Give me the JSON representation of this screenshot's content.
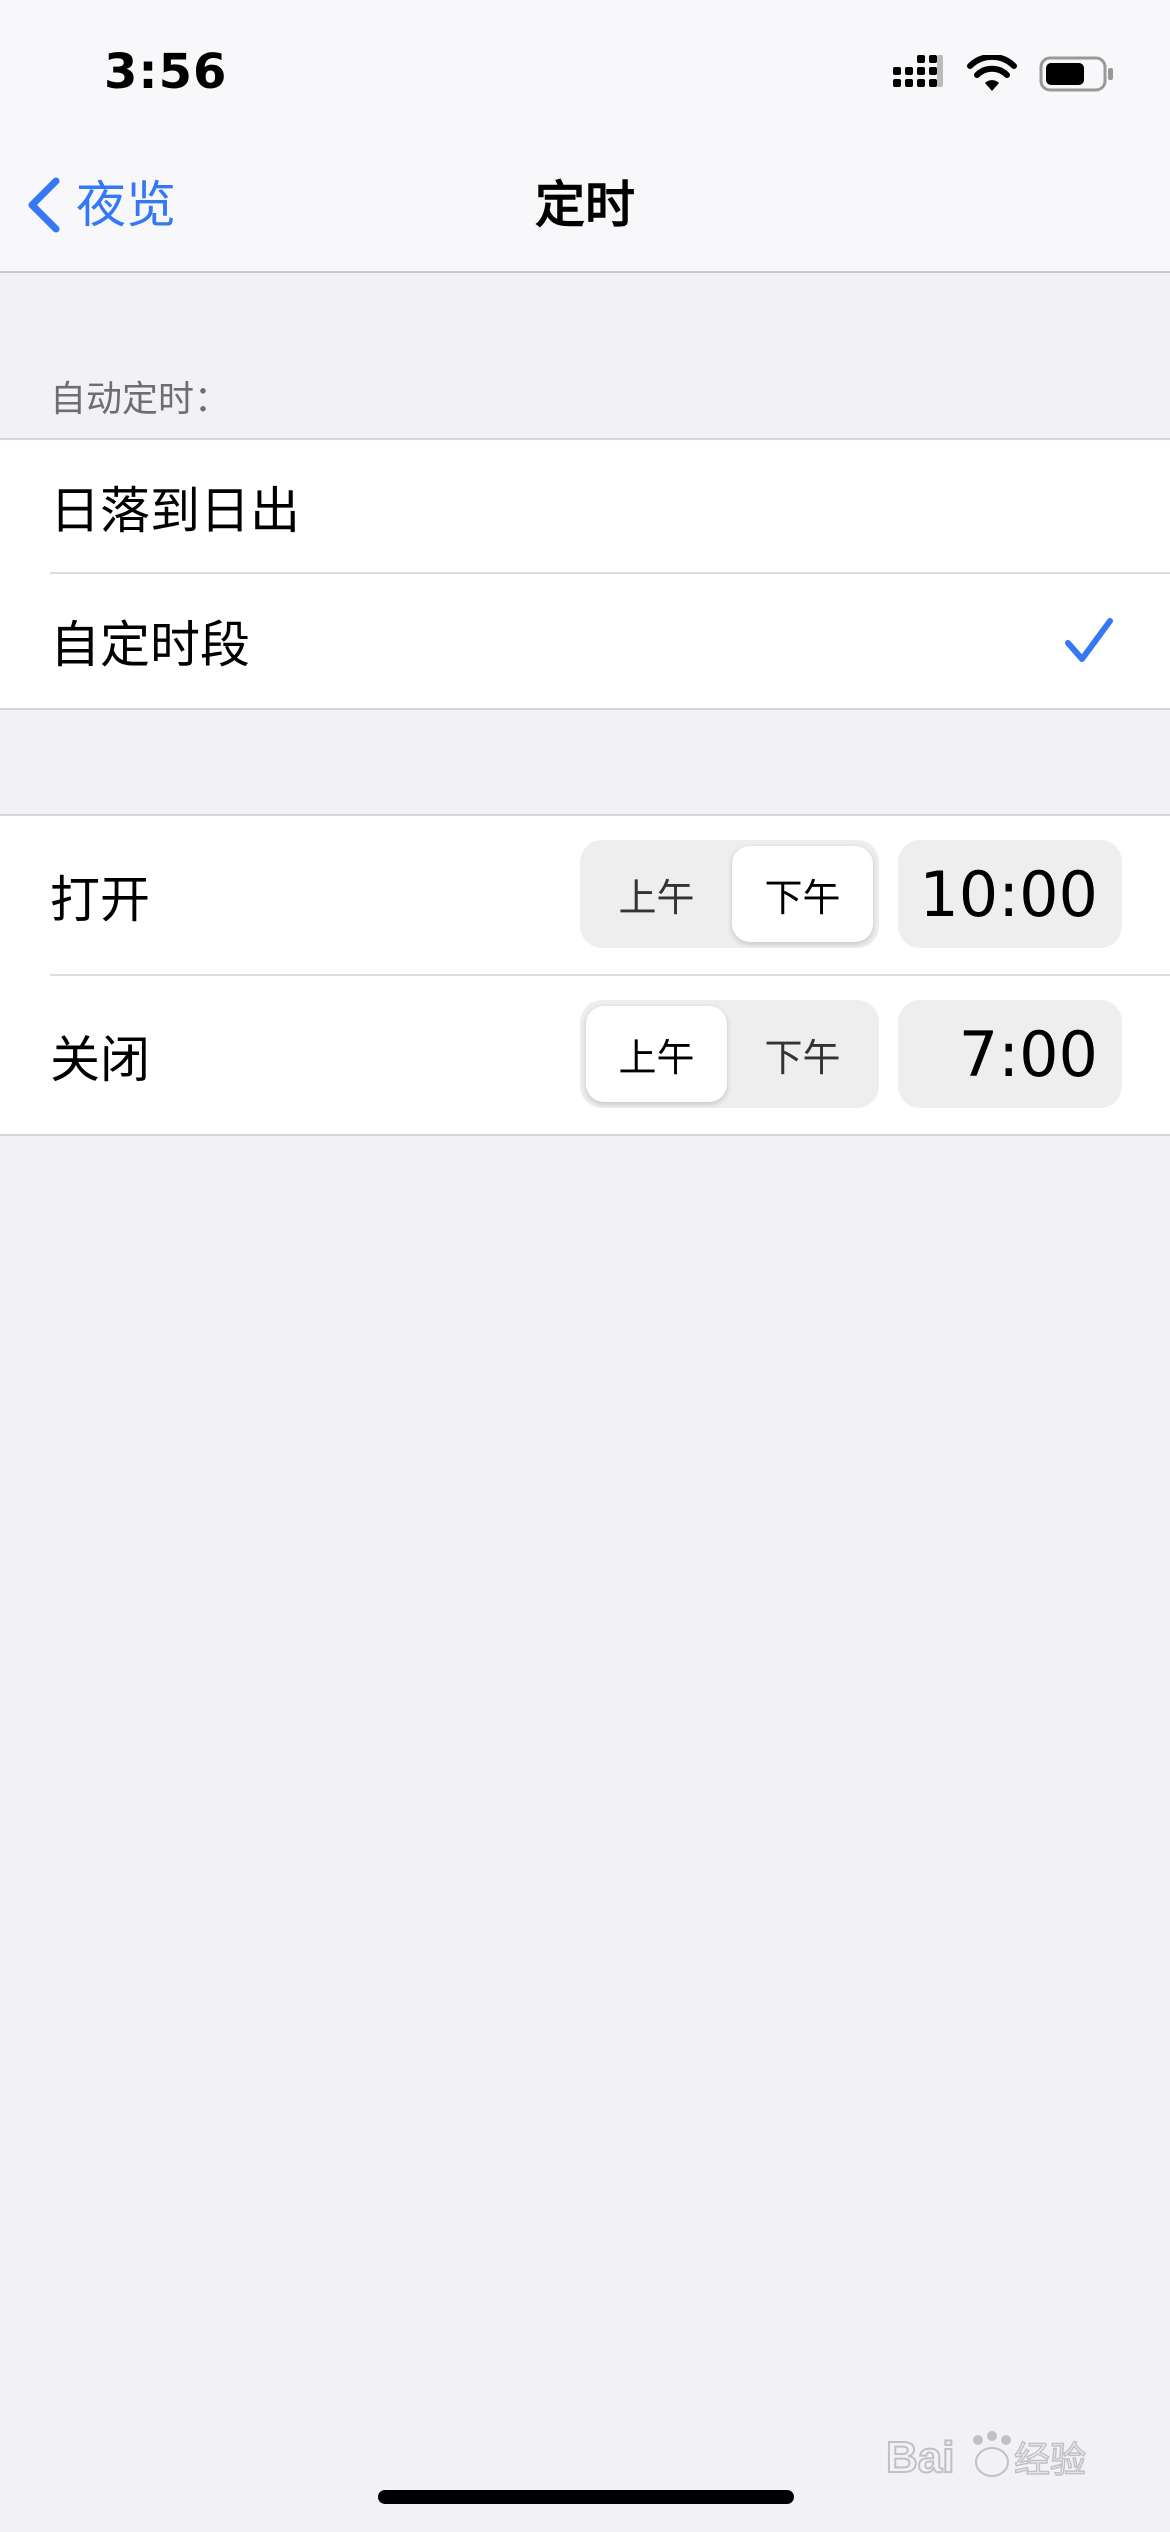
{
  "status_bar": {
    "time": "3:56",
    "icons": [
      "cellular-signal-icon",
      "wifi-icon",
      "battery-icon"
    ]
  },
  "nav": {
    "back_label": "夜览",
    "title": "定时"
  },
  "auto_schedule": {
    "header": "自动定时：",
    "options": [
      {
        "label": "日落到日出",
        "selected": false
      },
      {
        "label": "自定时段",
        "selected": true
      }
    ]
  },
  "schedule": {
    "on": {
      "label": "打开",
      "am_label": "上午",
      "pm_label": "下午",
      "period": "下午",
      "time": "10:00"
    },
    "off": {
      "label": "关闭",
      "am_label": "上午",
      "pm_label": "下午",
      "period": "上午",
      "time": "7:00"
    }
  },
  "colors": {
    "accent": "#3478f6",
    "background": "#f1f1f6",
    "cell": "#ffffff"
  }
}
